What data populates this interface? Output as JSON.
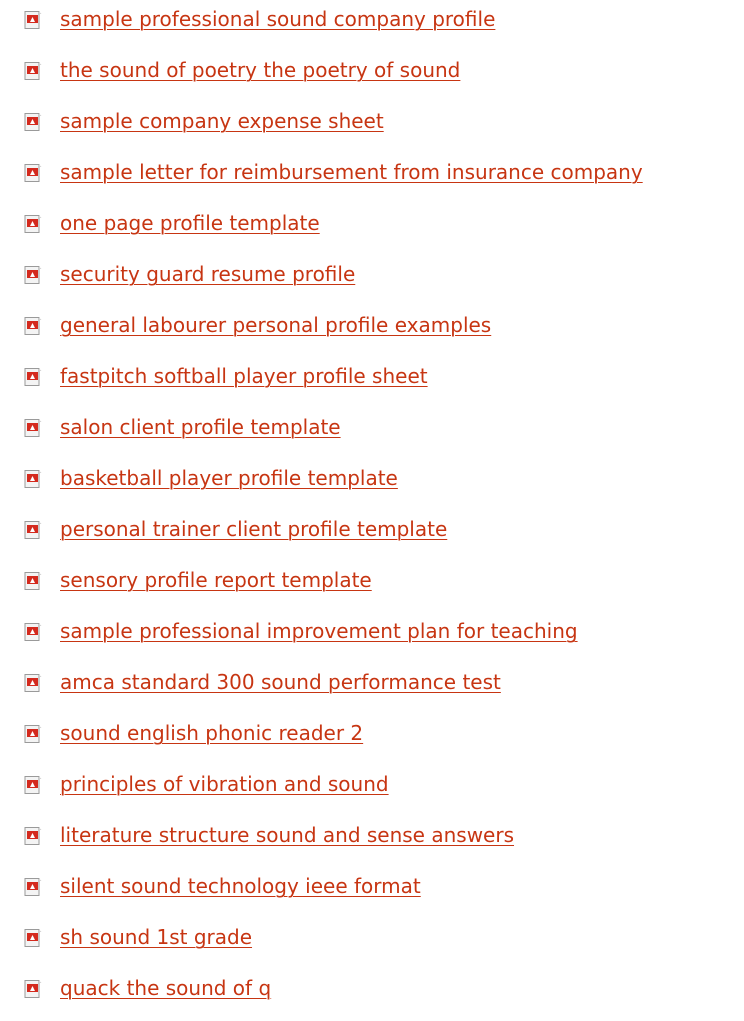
{
  "links": [
    {
      "label": "sample professional sound company profile",
      "icon": "pdf-file-icon"
    },
    {
      "label": "the sound of poetry the poetry of sound",
      "icon": "pdf-file-icon"
    },
    {
      "label": "sample company expense sheet",
      "icon": "pdf-file-icon"
    },
    {
      "label": "sample letter for reimbursement from insurance company",
      "icon": "pdf-file-icon"
    },
    {
      "label": "one page profile template",
      "icon": "pdf-file-icon"
    },
    {
      "label": "security guard resume profile",
      "icon": "pdf-file-icon"
    },
    {
      "label": "general labourer personal profile examples",
      "icon": "pdf-file-icon"
    },
    {
      "label": "fastpitch softball player profile sheet",
      "icon": "pdf-file-icon"
    },
    {
      "label": "salon client profile template",
      "icon": "pdf-file-icon"
    },
    {
      "label": "basketball player profile template",
      "icon": "pdf-file-icon"
    },
    {
      "label": "personal trainer client profile template",
      "icon": "pdf-file-icon"
    },
    {
      "label": "sensory profile report template",
      "icon": "pdf-file-icon"
    },
    {
      "label": "sample professional improvement plan for teaching",
      "icon": "pdf-file-icon"
    },
    {
      "label": "amca standard 300 sound performance test",
      "icon": "pdf-file-icon"
    },
    {
      "label": "sound english phonic reader 2",
      "icon": "pdf-file-icon"
    },
    {
      "label": "principles of vibration and sound",
      "icon": "pdf-file-icon"
    },
    {
      "label": "literature structure sound and sense answers",
      "icon": "pdf-file-icon"
    },
    {
      "label": "silent sound technology ieee format",
      "icon": "pdf-file-icon"
    },
    {
      "label": "sh sound 1st grade",
      "icon": "pdf-file-icon"
    },
    {
      "label": "quack the sound of q",
      "icon": "pdf-file-icon"
    }
  ],
  "colors": {
    "link": "#c73512",
    "icon_red": "#d42a1e",
    "icon_page": "#f4f4f4",
    "background": "#ffffff"
  }
}
